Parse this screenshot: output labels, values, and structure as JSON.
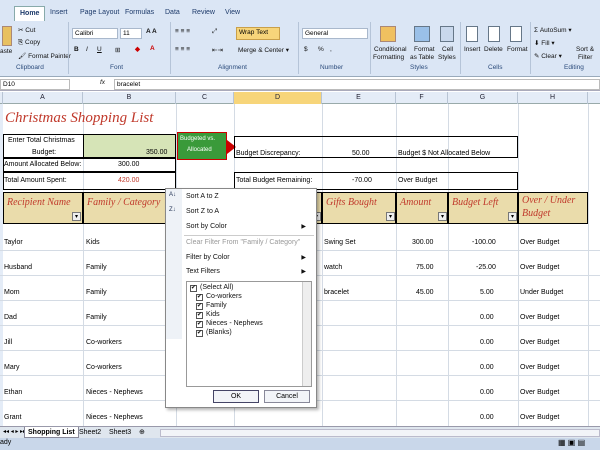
{
  "ribbon": {
    "tabs": [
      "Home",
      "Insert",
      "Page Layout",
      "Formulas",
      "Data",
      "Review",
      "View"
    ],
    "clipboard": {
      "paste": "aste",
      "cut": "Cut",
      "copy": "Copy",
      "format_painter": "Format Painter",
      "group": "Clipboard"
    },
    "font": {
      "name": "Calibri",
      "size": "11",
      "group": "Font"
    },
    "alignment": {
      "wrap": "Wrap Text",
      "merge": "Merge & Center",
      "group": "Alignment"
    },
    "number": {
      "format": "General",
      "group": "Number",
      "currency": "$",
      "percent": "%",
      "comma": ","
    },
    "styles": {
      "conditional": "Conditional",
      "conditional2": "Formatting",
      "format_table": "Format",
      "format_table2": "as Table",
      "cell_styles": "Cell",
      "cell_styles2": "Styles",
      "group": "Styles"
    },
    "cells": {
      "insert": "Insert",
      "delete": "Delete",
      "format": "Format",
      "group": "Cells"
    },
    "editing": {
      "autosum": "AutoSum",
      "fill": "Fill",
      "clear": "Clear",
      "sort": "Sort &",
      "sort2": "Filter",
      "group": "Editing"
    }
  },
  "formula_bar": {
    "name_box": "D10",
    "fx": "fx",
    "value": "bracelet"
  },
  "columns": [
    "A",
    "B",
    "C",
    "D",
    "E",
    "F",
    "G",
    "H"
  ],
  "sheet": {
    "title": "Christmas Shopping List",
    "budget_label1": "Enter Total Christmas",
    "budget_label2": "Budget:",
    "budget_value": "350.00",
    "allocated_label": "Amount Allocated Below:",
    "allocated_value": "300.00",
    "spent_label": "Total Amount Spent:",
    "spent_value": "420.00",
    "callout1": "Budgeted vs.",
    "callout2": "Allocated",
    "discrepancy_label": "Budget Discrepancy:",
    "discrepancy_value": "50.00",
    "discrepancy_note": "Budget $ Not Allocated Below",
    "remaining_label": "Total Budget Remaining:",
    "remaining_value": "-70.00",
    "remaining_note": "Over Budget"
  },
  "headers": {
    "recipient": "Recipient Name",
    "family": "Family / Category",
    "gifts": "Gifts Bought",
    "amount": "Amount",
    "left": "Budget Left",
    "over1": "Over / Under",
    "over2": "Budget"
  },
  "rows": [
    {
      "name": "Taylor",
      "cat": "Kids",
      "gift": "Swing Set",
      "amount": "300.00",
      "left": "-100.00",
      "status": "Over Budget"
    },
    {
      "name": "Husband",
      "cat": "Family",
      "gift": "watch",
      "amount": "75.00",
      "left": "-25.00",
      "status": "Over Budget"
    },
    {
      "name": "Mom",
      "cat": "Family",
      "gift": "bracelet",
      "amount": "45.00",
      "left": "5.00",
      "status": "Under Budget"
    },
    {
      "name": "Dad",
      "cat": "Family",
      "gift": "",
      "amount": "",
      "left": "0.00",
      "status": "Over Budget"
    },
    {
      "name": "Jill",
      "cat": "Co-workers",
      "gift": "",
      "amount": "",
      "left": "0.00",
      "status": "Over Budget"
    },
    {
      "name": "Mary",
      "cat": "Co-workers",
      "gift": "",
      "amount": "",
      "left": "0.00",
      "status": "Over Budget"
    },
    {
      "name": "Ethan",
      "cat": "Nieces - Nephews",
      "gift": "",
      "amount": "",
      "left": "0.00",
      "status": "Over Budget"
    },
    {
      "name": "Grant",
      "cat": "Nieces - Nephews",
      "gift": "",
      "amount": "",
      "left": "0.00",
      "status": "Over Budget"
    }
  ],
  "filter_menu": {
    "sort_az": "Sort A to Z",
    "sort_za": "Sort Z to A",
    "sort_color": "Sort by Color",
    "clear": "Clear Filter From \"Family / Category\"",
    "filter_color": "Filter by Color",
    "text_filters": "Text Filters",
    "options": [
      "(Select All)",
      "Co-workers",
      "Family",
      "Kids",
      "Nieces - Nephews",
      "(Blanks)"
    ],
    "ok": "OK",
    "cancel": "Cancel"
  },
  "sheet_tabs": [
    "Shopping List",
    "Sheet2",
    "Sheet3"
  ],
  "status": "ady",
  "colors": {
    "red": "#c0392b",
    "header_bg": "#eadcab",
    "callout": "#3a9a3a"
  }
}
